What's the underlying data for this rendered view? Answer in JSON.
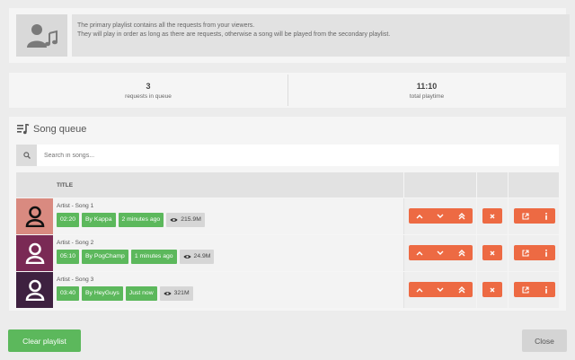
{
  "info": {
    "line1": "The primary playlist contains all the requests from your viewers.",
    "line2": "They will play in order as long as there are requests, otherwise a song will be played from the secondary playlist."
  },
  "stats": [
    {
      "value": "3",
      "label": "requests in queue"
    },
    {
      "value": "11:10",
      "label": "total playtime"
    }
  ],
  "queue": {
    "title": "Song queue",
    "search_placeholder": "Search in songs...",
    "column_title": "TITLE",
    "songs": [
      {
        "name": "Artist - Song 1",
        "duration": "02:20",
        "by": "By Kappa",
        "ago": "2 minutes ago",
        "views": "215.9M",
        "thumb_color": "#d98a80"
      },
      {
        "name": "Artist - Song 2",
        "duration": "05:10",
        "by": "By PogChamp",
        "ago": "1 minutes ago",
        "views": "24.9M",
        "thumb_color": "#7a2a55"
      },
      {
        "name": "Artist - Song 3",
        "duration": "03:40",
        "by": "By HeyGuys",
        "ago": "Just now",
        "views": "321M",
        "thumb_color": "#3e2140"
      }
    ]
  },
  "footer": {
    "clear_label": "Clear playlist",
    "close_label": "Close"
  },
  "colors": {
    "accent_orange": "#ed6a43",
    "tag_green": "#5cb85c"
  }
}
